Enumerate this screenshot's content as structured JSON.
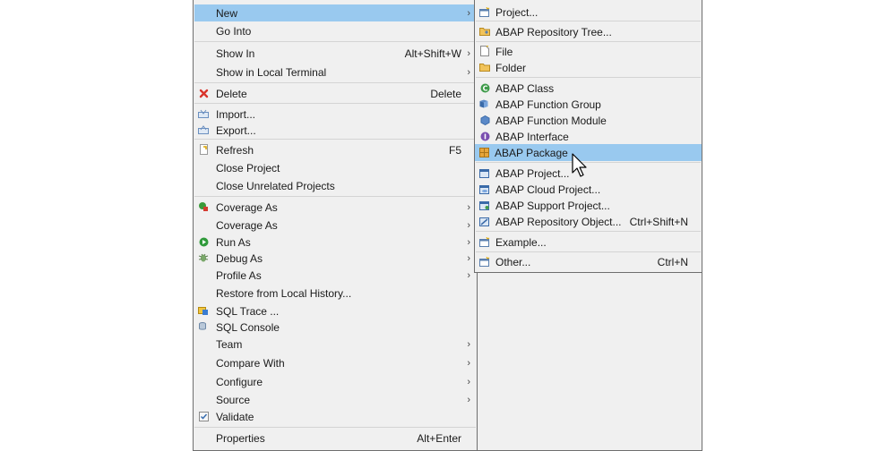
{
  "context_menu": {
    "items": [
      {
        "label": "New",
        "arrow": "›",
        "icon": ""
      },
      {
        "label": "Go Into",
        "icon": ""
      },
      {
        "label": "Show In",
        "shortcut": "Alt+Shift+W",
        "arrow": "›",
        "icon": ""
      },
      {
        "label": "Show in Local Terminal",
        "arrow": "›",
        "icon": ""
      },
      {
        "label": "Delete",
        "shortcut": "Delete",
        "icon": "delete-icon"
      },
      {
        "label": "Import...",
        "icon": "import-icon"
      },
      {
        "label": "Export...",
        "icon": "export-icon"
      },
      {
        "label": "Refresh",
        "shortcut": "F5",
        "icon": "refresh-icon"
      },
      {
        "label": "Close Project",
        "icon": ""
      },
      {
        "label": "Close Unrelated Projects",
        "icon": ""
      },
      {
        "label": "Coverage As",
        "arrow": "›",
        "icon": "coverage-icon"
      },
      {
        "label": "Coverage As",
        "arrow": "›",
        "icon": ""
      },
      {
        "label": "Run As",
        "arrow": "›",
        "icon": "run-icon"
      },
      {
        "label": "Debug As",
        "arrow": "›",
        "icon": "debug-icon"
      },
      {
        "label": "Profile As",
        "arrow": "›",
        "icon": ""
      },
      {
        "label": "Restore from Local History...",
        "icon": ""
      },
      {
        "label": "SQL Trace ...",
        "icon": "sql-trace-icon"
      },
      {
        "label": "SQL Console",
        "icon": "sql-console-icon"
      },
      {
        "label": "Team",
        "arrow": "›",
        "icon": ""
      },
      {
        "label": "Compare With",
        "arrow": "›",
        "icon": ""
      },
      {
        "label": "Configure",
        "arrow": "›",
        "icon": ""
      },
      {
        "label": "Source",
        "arrow": "›",
        "icon": ""
      },
      {
        "label": "Validate",
        "icon": "validate-check-icon"
      },
      {
        "label": "Properties",
        "shortcut": "Alt+Enter",
        "icon": ""
      }
    ]
  },
  "new_submenu": {
    "items": [
      {
        "label": "Project...",
        "icon": "project-icon"
      },
      {
        "label": "ABAP Repository Tree...",
        "icon": "repository-tree-icon"
      },
      {
        "label": "File",
        "icon": "file-icon"
      },
      {
        "label": "Folder",
        "icon": "folder-icon"
      },
      {
        "label": "ABAP Class",
        "icon": "abap-class-icon"
      },
      {
        "label": "ABAP Function Group",
        "icon": "function-group-icon"
      },
      {
        "label": "ABAP Function Module",
        "icon": "function-module-icon"
      },
      {
        "label": "ABAP Interface",
        "icon": "abap-interface-icon"
      },
      {
        "label": "ABAP Package",
        "icon": "abap-package-icon"
      },
      {
        "label": "ABAP Project...",
        "icon": "abap-project-icon"
      },
      {
        "label": "ABAP Cloud Project...",
        "icon": "abap-cloud-project-icon"
      },
      {
        "label": "ABAP Support Project...",
        "icon": "abap-support-project-icon"
      },
      {
        "label": "ABAP Repository Object...",
        "shortcut": "Ctrl+Shift+N",
        "icon": "repository-object-icon"
      },
      {
        "label": "Example...",
        "icon": "example-icon"
      },
      {
        "label": "Other...",
        "shortcut": "Ctrl+N",
        "icon": "other-icon"
      }
    ]
  },
  "colors": {
    "highlight": "#99c9ef",
    "menu_bg": "#f0f0f0",
    "border": "#6e6e6e"
  }
}
